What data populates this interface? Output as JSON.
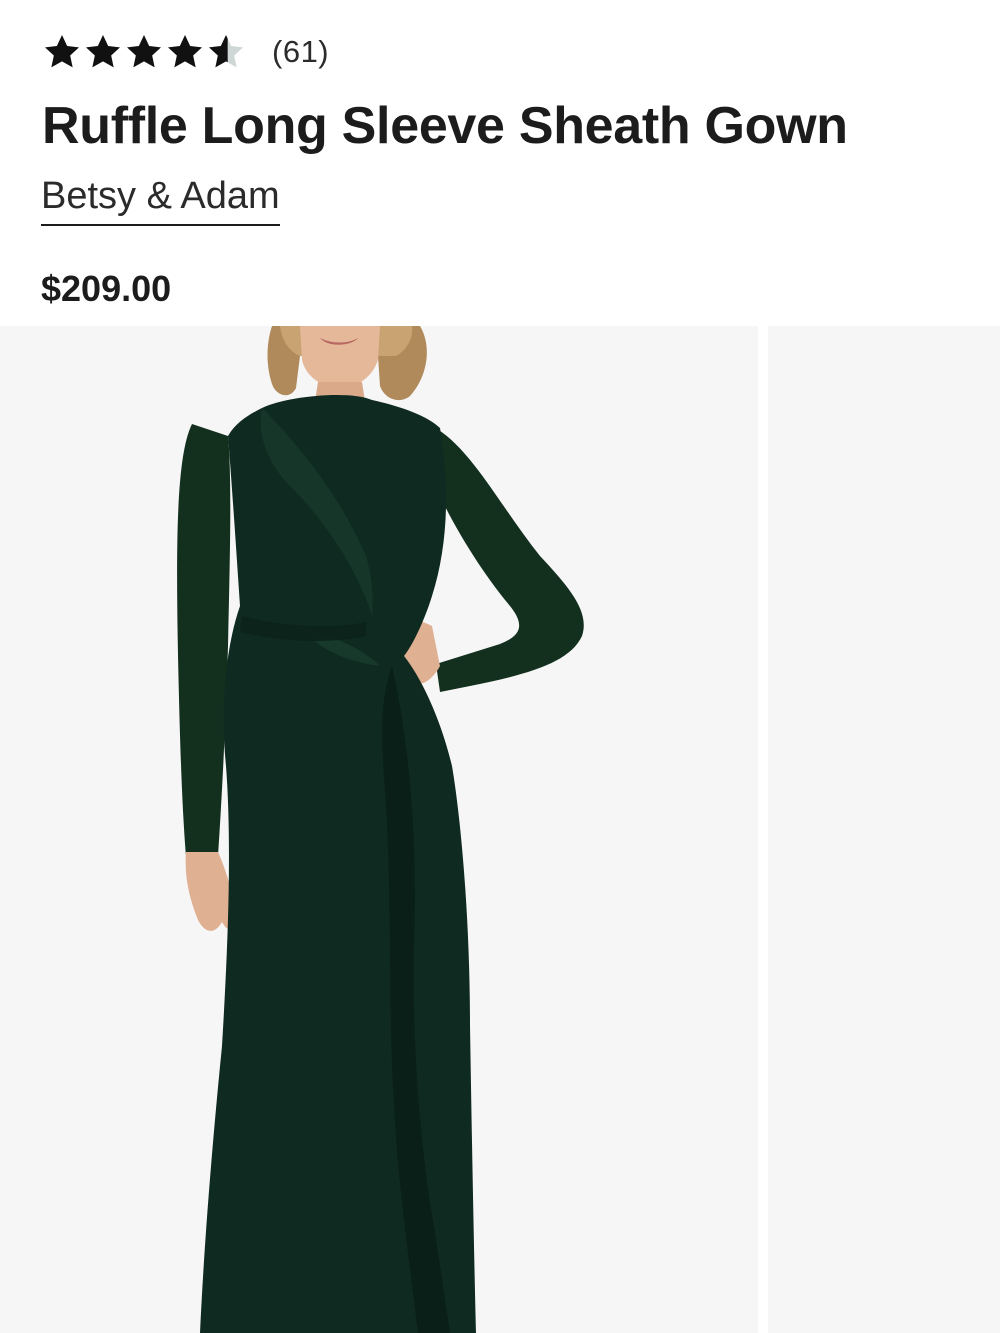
{
  "product": {
    "rating": {
      "stars": 4.5,
      "max_stars": 5,
      "review_count_label": "(61)",
      "star_color": "#111111",
      "star_empty_color": "#cfd6d6"
    },
    "title": "Ruffle Long Sleeve Sheath Gown",
    "brand": "Betsy & Adam",
    "price": "$209.00"
  },
  "gallery": {
    "background_color": "#f6f6f6",
    "dress_color": "#0f2a20",
    "images": [
      {
        "name": "primary-product-photo",
        "icon": "dress-model-photo"
      },
      {
        "name": "next-product-photo",
        "icon": "photo-placeholder"
      }
    ]
  }
}
